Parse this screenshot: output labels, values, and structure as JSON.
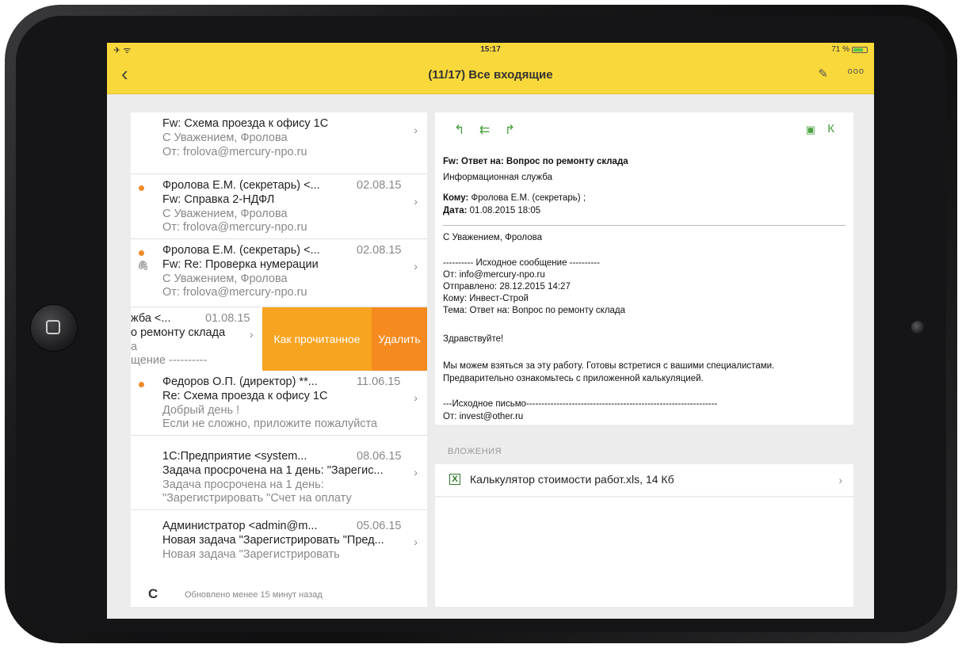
{
  "statusbar": {
    "left": "✈ ᯤ",
    "time": "15:17",
    "battery": "71 %"
  },
  "navbar": {
    "back": "‹",
    "title": "(11/17) Все входящие",
    "edit": "✎",
    "more": "ooo"
  },
  "mails": [
    {
      "l1": "Fw: Схема проезда к офису 1С",
      "l2": "С Уважением, Фролова",
      "l3": "От: frolova@mercury-npo.ru"
    },
    {
      "from": "Фролова Е.М. (секретарь) <...",
      "date": "02.08.15",
      "subject": "Fw: Справка 2-НДФЛ",
      "p1": "С Уважением, Фролова",
      "p2": "От: frolova@mercury-npo.ru"
    },
    {
      "from": "Фролова Е.М. (секретарь) <...",
      "date": "02.08.15",
      "subject": "Fw: Re: Проверка нумерации",
      "p1": "С Уважением, Фролова",
      "p2": "От: frolova@mercury-npo.ru"
    },
    {
      "from": "Федоров О.П. (директор) **...",
      "date": "11.06.15",
      "subject": "Re: Схема проезда к офису 1С",
      "p1": "Добрый день !",
      "p2": "Если не сложно, приложите пожалуйста"
    },
    {
      "from": "1С:Предприятие <system...",
      "date": "08.06.15",
      "subject": "Задача просрочена на 1 день: \"Зарегис...",
      "p1": "Задача просрочена на 1 день:",
      "p2": "\"Зарегистрировать \"Счет на оплату"
    },
    {
      "from": "Администратор <admin@m...",
      "date": "05.06.15",
      "subject": "Новая задача \"Зарегистрировать \"Пред...",
      "p1": "Новая задача \"Зарегистрировать"
    }
  ],
  "swipe": {
    "from": "жба <...",
    "date": "01.08.15",
    "subject": "о ремонту склада",
    "p1": "а",
    "p2": "щение ----------",
    "mark_read": "Как прочитанное",
    "delete": "Удалить"
  },
  "refresh": {
    "icon": "C",
    "text": "Обновлено менее 15 минут назад"
  },
  "message": {
    "actions": {
      "reply": "↰",
      "reply_all": "⇇",
      "forward": "↱",
      "folder": "▣",
      "k": "К"
    },
    "subject": "Fw: Ответ на: Вопрос по ремонту склада",
    "sender": "Информационная служба",
    "to_label": "Кому:",
    "to": "Фролова Е.М. (секретарь) ;",
    "date_label": "Дата:",
    "date": "01.08.2015 18:05",
    "body": [
      "С Уважением, Фролова",
      "---------- Исходное сообщение ----------",
      "От: info@mercury-npo.ru",
      "Отправлено: 28.12.2015 14:27",
      "Кому: Инвест-Строй",
      "Тема: Ответ на: Вопрос по ремонту склада",
      "Здравствуйте!",
      "Мы можем взяться за эту работу. Готовы встретися с вашими специалистами.",
      "Предварительно ознакомьтесь с приложенной калькуляцией.",
      "---Исходное письмо---------------------------------------------------------------",
      "От: invest@other.ru"
    ]
  },
  "attachments": {
    "label": "ВЛОЖЕНИЯ",
    "icon": "X",
    "file": "Калькулятор стоимости работ.xls, 14 Кб"
  }
}
